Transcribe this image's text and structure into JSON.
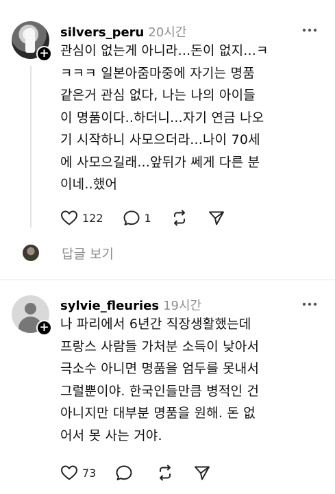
{
  "posts": [
    {
      "username": "silvers_peru",
      "timestamp": "20시간",
      "avatar": "user-photo-avatar",
      "lines": [
        "관심이 없는게 아니라...돈이 없지...ㅋ",
        "ㅋㅋㅋ 일본아줌마중에 자기는 명품",
        "같은거 관심 없다, 나는 나의 아이들",
        "이 명품이다..하더니...자기 연금 나오",
        "기 시작하니 사모으더라...나이 70세",
        "에 사모으길래...앞뒤가 쎄게 다른 분",
        "이네..했어"
      ],
      "likes": "122",
      "comments": "1",
      "replies_label": "답글 보기"
    },
    {
      "username": "sylvie_fleuries",
      "timestamp": "19시간",
      "avatar": "default-avatar",
      "lines": [
        "나 파리에서 6년간 직장생활했는데",
        "프랑스 사람들 가처분 소득이 낮아서",
        "극소수 아니면 명품을 엄두를 못내서",
        "그럴뿐이야. 한국인들만큼 병적인 건",
        "아니지만 대부분 명품을 원해. 돈 없",
        "어서 못 사는 거야."
      ],
      "likes": "73",
      "comments": ""
    }
  ],
  "icons": {
    "like": "heart-icon",
    "comment": "comment-bubble-icon",
    "repost": "repost-icon",
    "share": "send-icon",
    "more": "more-options-icon",
    "follow": "plus-icon"
  },
  "colors": {
    "text": "#111111",
    "muted": "#8e8e8e",
    "divider": "#e5e5e5"
  }
}
